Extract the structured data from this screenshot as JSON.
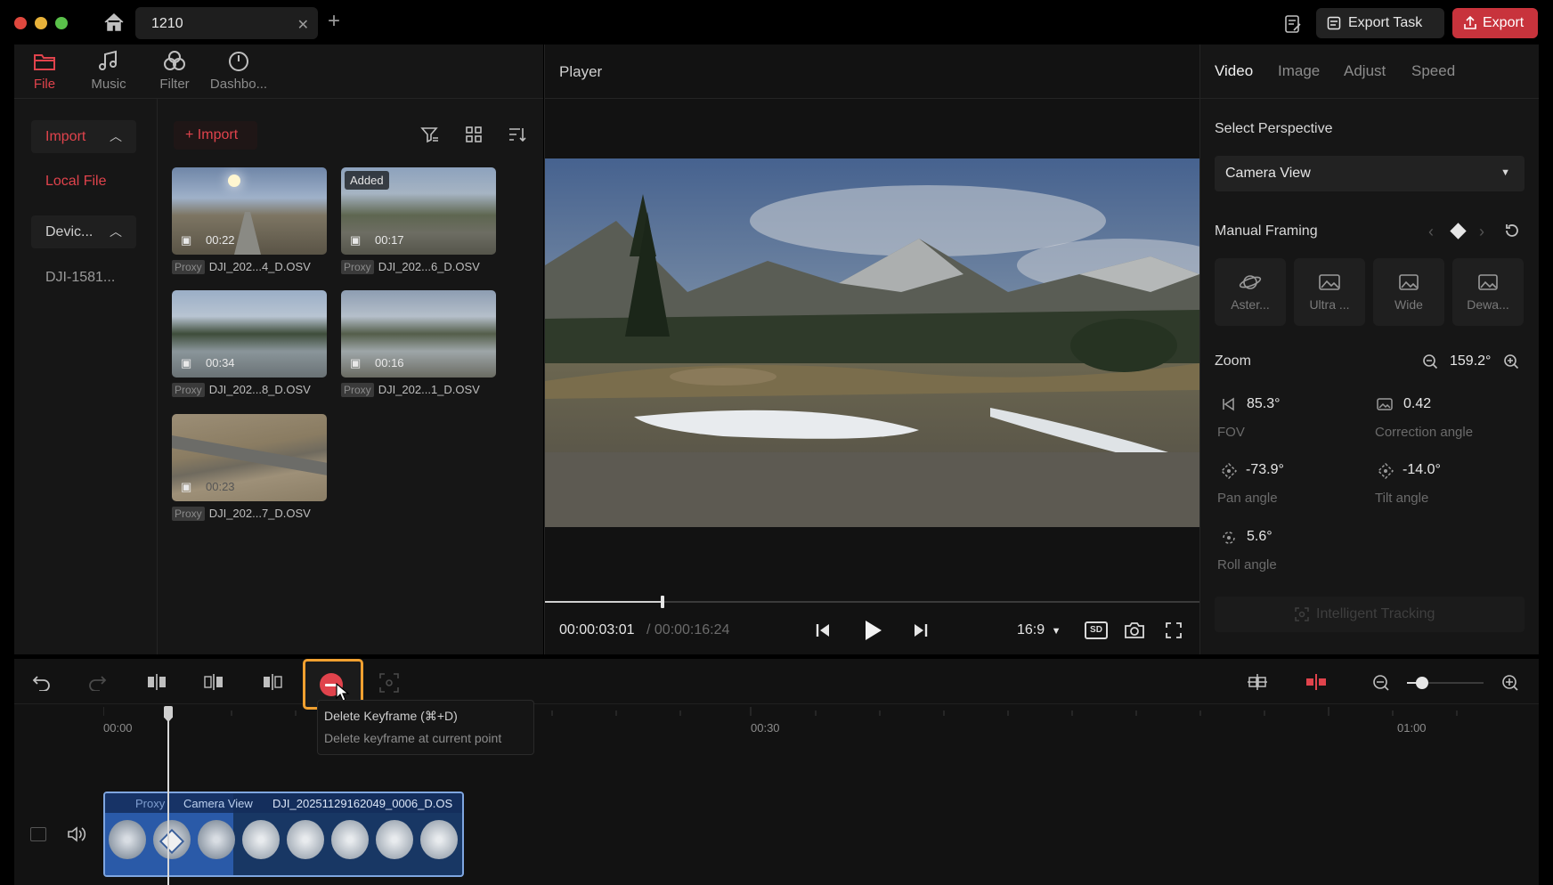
{
  "titlebar": {
    "tab_title": "1210",
    "export_task_label": "Export Task",
    "export_label": "Export"
  },
  "left_tabs": [
    {
      "label": "File",
      "active": true
    },
    {
      "label": "Music",
      "active": false
    },
    {
      "label": "Filter",
      "active": false
    },
    {
      "label": "Dashbo...",
      "active": false
    }
  ],
  "sidebar": {
    "import_label": "Import",
    "local_file_label": "Local File",
    "device_label": "Devic...",
    "device_item": "DJI-1581..."
  },
  "media": {
    "import_button": "+ Import",
    "items": [
      {
        "duration": "00:22",
        "name": "DJI_202...4_D.OSV",
        "proxy": "Proxy",
        "added": ""
      },
      {
        "duration": "00:17",
        "name": "DJI_202...6_D.OSV",
        "proxy": "Proxy",
        "added": "Added"
      },
      {
        "duration": "00:34",
        "name": "DJI_202...8_D.OSV",
        "proxy": "Proxy",
        "added": ""
      },
      {
        "duration": "00:16",
        "name": "DJI_202...1_D.OSV",
        "proxy": "Proxy",
        "added": ""
      },
      {
        "duration": "00:23",
        "name": "DJI_202...7_D.OSV",
        "proxy": "Proxy",
        "added": ""
      }
    ]
  },
  "player": {
    "title": "Player",
    "current_time": "00:00:03:01",
    "total_time": "/ 00:00:16:24",
    "aspect": "16:9",
    "progress": 0.18
  },
  "right_panel": {
    "tabs": [
      "Video",
      "Image",
      "Adjust",
      "Speed"
    ],
    "select_perspective_label": "Select Perspective",
    "perspective_value": "Camera View",
    "manual_framing_label": "Manual Framing",
    "framing_buttons": [
      "Aster...",
      "Ultra ...",
      "Wide",
      "Dewa..."
    ],
    "zoom_label": "Zoom",
    "zoom_value": "159.2°",
    "fov_value": "85.3°",
    "fov_label": "FOV",
    "correction_value": "0.42",
    "correction_label": "Correction angle",
    "pan_value": "-73.9°",
    "pan_label": "Pan angle",
    "tilt_value": "-14.0°",
    "tilt_label": "Tilt angle",
    "roll_value": "5.6°",
    "roll_label": "Roll angle",
    "tracking_label": "Intelligent Tracking"
  },
  "timeline": {
    "ruler": [
      "00:00",
      "00:30",
      "01:00"
    ],
    "tooltip_title": "Delete Keyframe (⌘+D)",
    "tooltip_desc": "Delete keyframe at current point",
    "clip_proxy": "Proxy",
    "clip_view": "Camera View",
    "clip_name": "DJI_20251129162049_0006_D.OS"
  },
  "colors": {
    "accent": "#e0434c",
    "highlight": "#f0a030",
    "clip_blue": "#1f4f9c"
  }
}
